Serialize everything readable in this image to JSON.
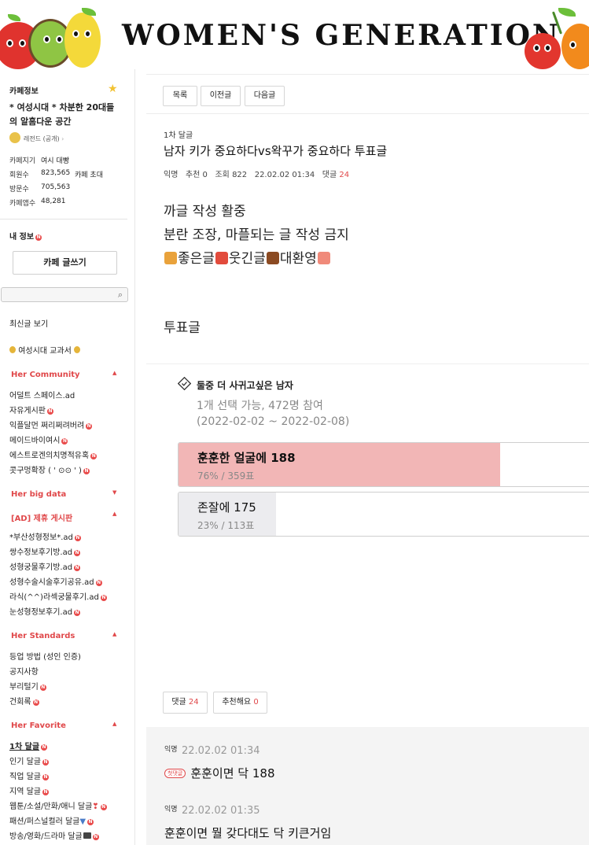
{
  "banner": {
    "title": "WOMEN'S GENERATION"
  },
  "sidebar": {
    "cafe_info_label": "카페정보",
    "cafe_desc": [
      "* 여성시대 *  차분한 20대들",
      "의 알흠다운 공간"
    ],
    "level": "레전드 (공개)",
    "info": [
      {
        "label": "카페지기",
        "value": "여시 대빵"
      },
      {
        "label": "회원수",
        "value": "823,565",
        "extra": "카페 초대"
      },
      {
        "label": "방문수",
        "value": "705,563"
      },
      {
        "label": "카페앱수",
        "value": "48,281"
      }
    ],
    "my_info": "내 정보",
    "write_button": "카페 글쓰기",
    "recent_posts": "최신글 보기",
    "textbook": "여성시대 교과서",
    "groups": [
      {
        "title": "Her Community",
        "expanded": true,
        "items": [
          "어덜트 스페이스.ad",
          "자유게시판",
          "익플달먼 쩌리쩌려버려",
          "메이드바이여시",
          "에스트로겐의치명적유혹",
          "콧구멍확장 ( ' ⊙⊙ ' )"
        ]
      },
      {
        "title": "Her big data",
        "expanded": false,
        "items": []
      },
      {
        "title": "[AD] 제휴 게시판",
        "expanded": true,
        "items": [
          "*부산성형정보*.ad",
          "쌍수정보후기방.ad",
          "성형궁물후기방.ad",
          "성형수술시술후기공유.ad",
          "라식(^^)라섹궁물후기.ad",
          "눈성형정보후기.ad"
        ]
      },
      {
        "title": "Her Standards",
        "expanded": true,
        "items": [
          "등업 방법 (성인 인증)",
          "공지사항",
          "부리털기",
          "건회록"
        ]
      },
      {
        "title": "Her Favorite",
        "expanded": true,
        "items": [
          "1차 달글",
          "인기 달글",
          "직업 달글",
          "지역 달글",
          "웹툰/소설/만화/애니 달글",
          "패션/퍼스널컬러 달글",
          "방송/영화/드라마 달글"
        ]
      }
    ]
  },
  "nav": {
    "list": "목록",
    "prev": "이전글",
    "next": "다음글"
  },
  "post": {
    "category": "1차 달글",
    "title": "남자 키가 중요하다vs왁꾸가 중요하다 투표글",
    "author": "익명",
    "recommend_label": "추천",
    "recommend": "0",
    "views_label": "조회",
    "views": "822",
    "date": "22.02.02 01:34",
    "comments_label": "댓글",
    "comments": "24",
    "body_lines": [
      "까글 작성 활중",
      "분란 조장, 마플되는 글 작성 금지"
    ],
    "body_emoji_line": [
      "좋은글",
      "웃긴글",
      "대환영"
    ],
    "vote_heading": "투표글"
  },
  "poll": {
    "question": "둘중 더 사귀고싶은 남자",
    "meta": "1개 선택 가능, 472명 참여",
    "period": "(2022-02-02 ~ 2022-02-08)",
    "options": [
      {
        "label": "훈훈한 얼굴에 188",
        "stat": "76% / 359표",
        "percent": 76,
        "color": "#f2b6b6",
        "leading": true
      },
      {
        "label": "존잘에 175",
        "stat": "23% / 113표",
        "percent": 23,
        "color": "#ececef",
        "leading": false
      }
    ]
  },
  "footer": {
    "comments_label": "댓글",
    "comments": "24",
    "recommend_label": "추천해요",
    "recommend": "0"
  },
  "comments": [
    {
      "author": "익명",
      "date": "22.02.02 01:34",
      "badge": "첫댓글",
      "text": "훈훈이면 닥 188"
    },
    {
      "author": "익명",
      "date": "22.02.02 01:35",
      "text": "훈훈이면 뭘 갖다대도 닥 키큰거임"
    }
  ]
}
